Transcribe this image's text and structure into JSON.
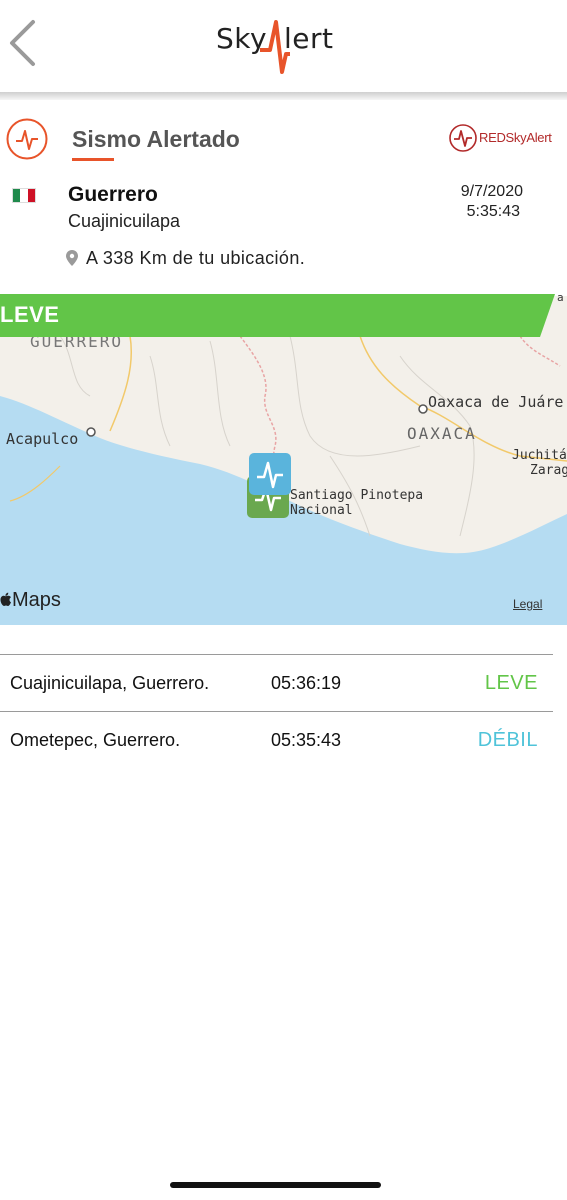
{
  "app": {
    "logo_left": "Sky",
    "logo_right": "lert"
  },
  "header": {
    "title": "Sismo Alertado",
    "partner_logo": "REDSkyAlert"
  },
  "event": {
    "flag": "mexico-flag",
    "state": "Guerrero",
    "city": "Cuajinicuilapa",
    "date": "9/7/2020",
    "time": "5:35:43",
    "distance": "A 338 Km de tu ubicación."
  },
  "map": {
    "intensity": "LEVE",
    "intensity_color": "#62c548",
    "labels": {
      "guerrero": "GUERRERO",
      "acapulco": "Acapulco",
      "oaxaca_city": "Oaxaca de Juáre",
      "oaxaca_state": "OAXACA",
      "juchitan_1": "Juchitán",
      "juchitan_2": "Zarag",
      "santiago_1": "Santiago Pinotepa",
      "santiago_2": "Nacional"
    },
    "brand": "Maps",
    "legal": "Legal",
    "marker_colors": [
      "#5ab4dc",
      "#6aa84f"
    ]
  },
  "reports": [
    {
      "place": "Cuajinicuilapa, Guerrero.",
      "time": "05:36:19",
      "level": "LEVE",
      "color": "#62c548"
    },
    {
      "place": "Ometepec, Guerrero.",
      "time": "05:35:43",
      "level": "DÉBIL",
      "color": "#4fc3d9"
    }
  ],
  "colors": {
    "accent": "#e8542a",
    "ocean": "#b5dcf2"
  }
}
